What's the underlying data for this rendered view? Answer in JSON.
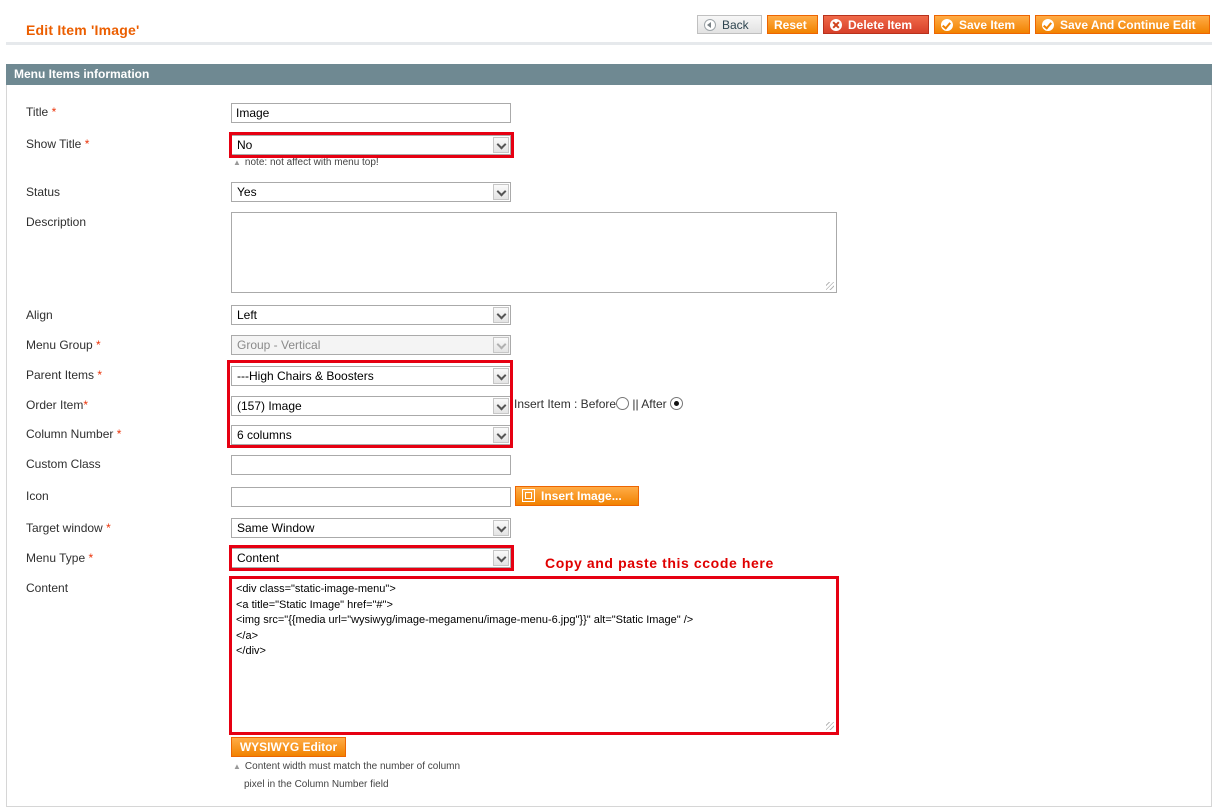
{
  "header": {
    "title": "Edit Item 'Image'",
    "buttons": {
      "back": "Back",
      "reset": "Reset",
      "delete": "Delete Item",
      "save": "Save Item",
      "save_continue": "Save And Continue Edit"
    }
  },
  "section": {
    "title": "Menu Items information"
  },
  "fields": {
    "title": {
      "label": "Title",
      "value": "Image"
    },
    "show_title": {
      "label": "Show Title",
      "value": "No",
      "note": "note: not affect with menu top!"
    },
    "status": {
      "label": "Status",
      "value": "Yes"
    },
    "description": {
      "label": "Description",
      "value": ""
    },
    "align": {
      "label": "Align",
      "value": "Left"
    },
    "menu_group": {
      "label": "Menu Group",
      "value": "Group - Vertical"
    },
    "parent_items": {
      "label": "Parent Items",
      "value": "---High Chairs & Boosters"
    },
    "order_item": {
      "label": "Order Item",
      "value": "(157) Image",
      "insert_label": "Insert Item : Before",
      "separator": "|| After"
    },
    "column_number": {
      "label": "Column Number",
      "value": "6 columns"
    },
    "custom_class": {
      "label": "Custom Class",
      "value": ""
    },
    "icon": {
      "label": "Icon",
      "value": "",
      "button": "Insert Image..."
    },
    "target_window": {
      "label": "Target window",
      "value": "Same Window"
    },
    "menu_type": {
      "label": "Menu Type",
      "value": "Content"
    },
    "content": {
      "label": "Content",
      "value": "<div class=\"static-image-menu\">\n<a title=\"Static Image\" href=\"#\">\n<img src=\"{{media url=\"wysiwyg/image-megamenu/image-menu-6.jpg\"}}\" alt=\"Static Image\" />\n</a>\n</div>",
      "wysiwyg_button": "WYSIWYG Editor",
      "help_line1": "Content width must match the number of column",
      "help_line2": "pixel in the Column Number field"
    }
  },
  "annotation": "Copy and paste this ccode here",
  "required_mark": "*",
  "colors": {
    "accent": "#eb5e00",
    "highlight": "#e60012",
    "section_bar": "#6f8992"
  }
}
